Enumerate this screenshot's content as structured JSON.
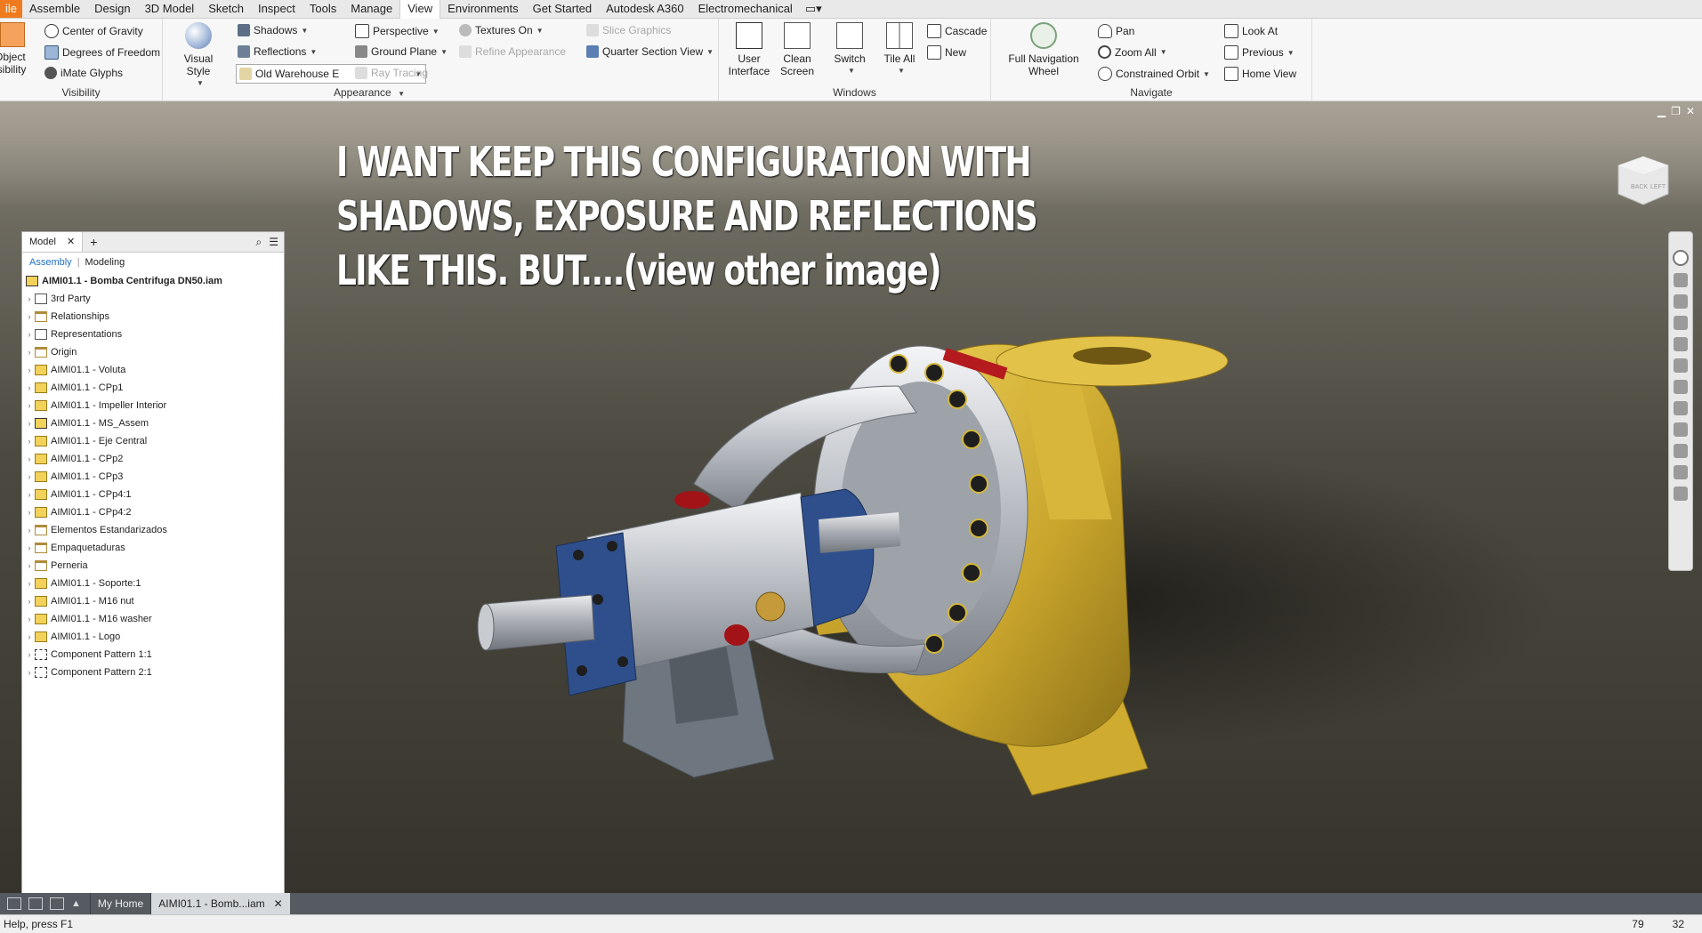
{
  "menu": {
    "tabs": [
      "ile",
      "Assemble",
      "Design",
      "3D Model",
      "Sketch",
      "Inspect",
      "Tools",
      "Manage",
      "View",
      "Environments",
      "Get Started",
      "Autodesk A360",
      "Electromechanical"
    ],
    "active_tab": "View"
  },
  "ribbon": {
    "visibility": {
      "object_visibility": "Object\nisibility",
      "center_of_gravity": "Center of Gravity",
      "degrees_of_freedom": "Degrees of Freedom",
      "imate_glyphs": "iMate Glyphs",
      "title": "Visibility"
    },
    "appearance": {
      "visual_style": "Visual Style",
      "shadows": "Shadows",
      "reflections": "Reflections",
      "lighting_value": "Old Warehouse E",
      "perspective": "Perspective",
      "ground_plane": "Ground Plane",
      "ray_tracing": "Ray Tracing",
      "textures_on": "Textures On",
      "refine_appearance": "Refine Appearance",
      "title": "Appearance"
    },
    "view_tools": {
      "slice_graphics": "Slice Graphics",
      "quarter_section_view": "Quarter Section View"
    },
    "windows": {
      "user_interface": "User\nInterface",
      "clean_screen": "Clean\nScreen",
      "switch": "Switch",
      "tile_all": "Tile All",
      "cascade": "Cascade",
      "new": "New",
      "title": "Windows"
    },
    "navigate": {
      "full_navigation_wheel": "Full Navigation\nWheel",
      "pan": "Pan",
      "zoom_all": "Zoom All",
      "constrained_orbit": "Constrained Orbit",
      "look_at": "Look At",
      "previous": "Previous",
      "home_view": "Home View",
      "title": "Navigate"
    }
  },
  "viewport": {
    "overlay_lines": [
      "I WANT KEEP THIS CONFIGURATION WITH",
      "SHADOWS, EXPOSURE AND REFLECTIONS",
      "LIKE THIS. BUT....(view other image)"
    ],
    "viewcube_faces": [
      "BACK",
      "LEFT"
    ],
    "pump_colors": {
      "casing": "#d6b43a",
      "bracket": "#c9ccd1",
      "flange": "#2f4f8c",
      "foot": "#6e7680",
      "bolt": "#8b0f12"
    }
  },
  "browser": {
    "tab_label": "Model",
    "subtabs": [
      "Assembly",
      "Modeling"
    ],
    "root": "AIMI01.1 - Bomba Centrifuga DN50.iam",
    "items": [
      {
        "label": "3rd Party",
        "icon": "sub"
      },
      {
        "label": "Relationships",
        "icon": "folder"
      },
      {
        "label": "Representations",
        "icon": "sub"
      },
      {
        "label": "Origin",
        "icon": "folder"
      },
      {
        "label": "AIMI01.1 - Voluta",
        "icon": "part"
      },
      {
        "label": "AIMI01.1 - CPp1",
        "icon": "part"
      },
      {
        "label": "AIMI01.1 - Impeller Interior",
        "icon": "part"
      },
      {
        "label": "AIMI01.1 - MS_Assem",
        "icon": "asm"
      },
      {
        "label": "AIMI01.1 - Eje Central",
        "icon": "part"
      },
      {
        "label": "AIMI01.1 - CPp2",
        "icon": "part"
      },
      {
        "label": "AIMI01.1 - CPp3",
        "icon": "part"
      },
      {
        "label": "AIMI01.1 - CPp4:1",
        "icon": "part"
      },
      {
        "label": "AIMI01.1 - CPp4:2",
        "icon": "part"
      },
      {
        "label": "Elementos Estandarizados",
        "icon": "folder"
      },
      {
        "label": "Empaquetaduras",
        "icon": "folder"
      },
      {
        "label": "Perneria",
        "icon": "folder"
      },
      {
        "label": "AIMI01.1 - Soporte:1",
        "icon": "part"
      },
      {
        "label": "AIMI01.1 - M16 nut",
        "icon": "part"
      },
      {
        "label": "AIMI01.1 - M16 washer",
        "icon": "part"
      },
      {
        "label": "AIMI01.1 - Logo",
        "icon": "part"
      },
      {
        "label": "Component Pattern 1:1",
        "icon": "pattern"
      },
      {
        "label": "Component Pattern 2:1",
        "icon": "pattern"
      }
    ]
  },
  "doc_tabs": {
    "home": "My Home",
    "active": "AIMI01.1 - Bomb...iam"
  },
  "status": {
    "help": "Help, press F1",
    "num1": "79",
    "num2": "32"
  }
}
